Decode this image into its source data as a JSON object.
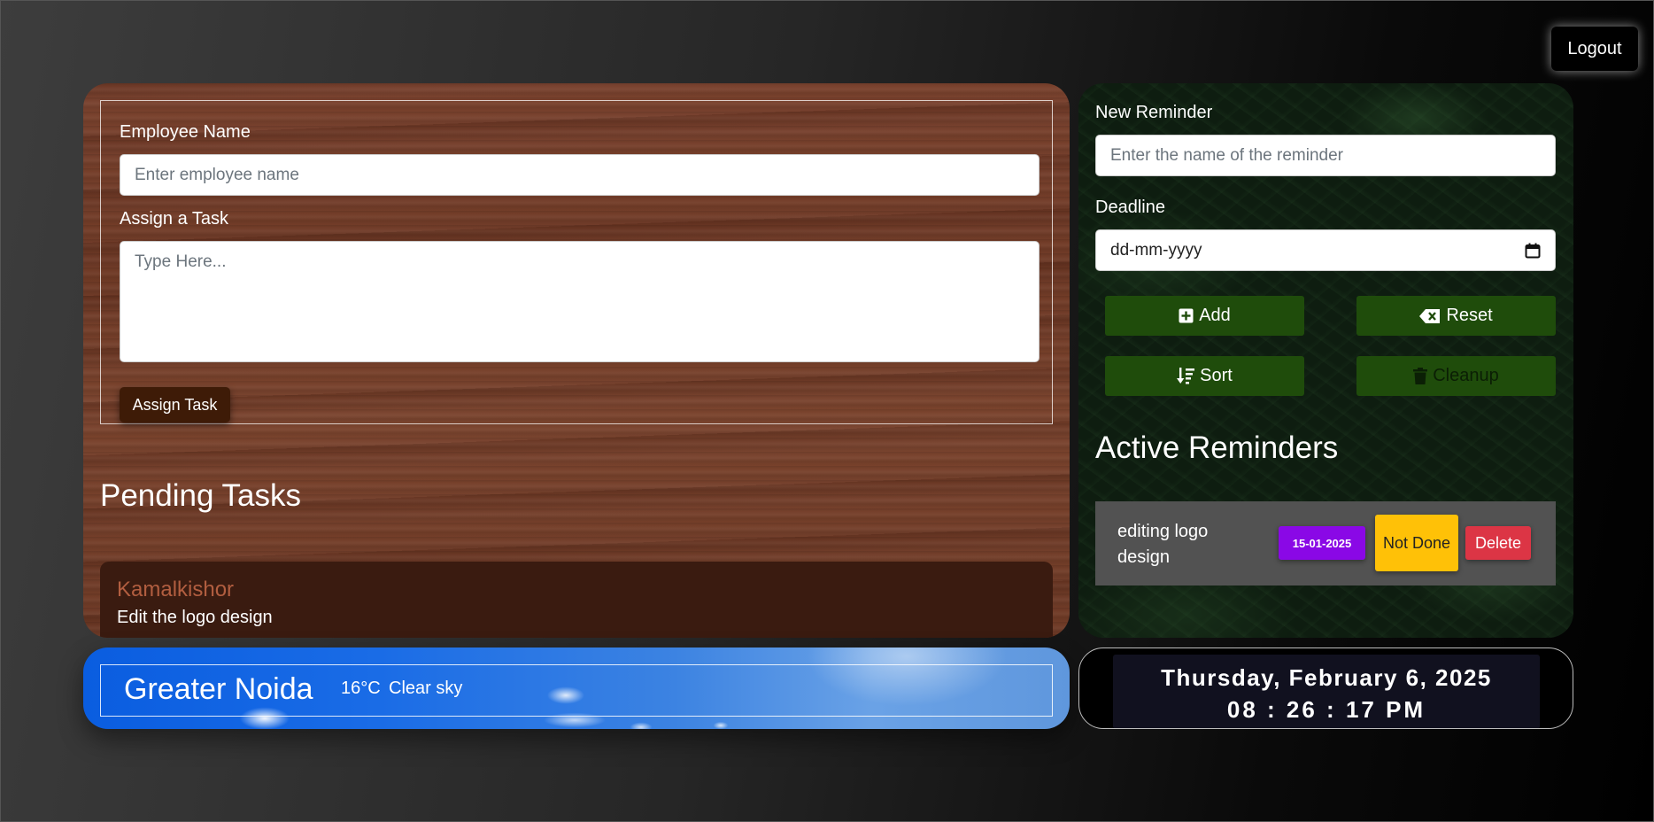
{
  "header": {
    "logout_label": "Logout"
  },
  "task_form": {
    "employee_label": "Employee Name",
    "employee_placeholder": "Enter employee name",
    "task_label": "Assign a Task",
    "task_placeholder": "Type Here...",
    "assign_button": "Assign Task"
  },
  "pending": {
    "title": "Pending Tasks",
    "tasks": [
      {
        "employee": "Kamalkishor",
        "task": "Edit the logo design"
      }
    ]
  },
  "reminder_form": {
    "name_label": "New Reminder",
    "name_placeholder": "Enter the name of the reminder",
    "deadline_label": "Deadline",
    "deadline_placeholder": "dd-mm-yyyy",
    "buttons": {
      "add": "Add",
      "reset": "Reset",
      "sort": "Sort",
      "cleanup": "Cleanup"
    }
  },
  "active_reminders": {
    "title": "Active Reminders",
    "items": [
      {
        "name": "editing logo design",
        "date": "15-01-2025",
        "status_button": "Not Done",
        "delete_button": "Delete"
      }
    ]
  },
  "weather": {
    "city": "Greater Noida",
    "temperature": "16°C",
    "condition": "Clear sky"
  },
  "clock": {
    "date": "Thursday, February 6, 2025",
    "time": "08 : 26 : 17 PM"
  },
  "icons": {
    "add": "plus-square-icon",
    "reset": "backspace-icon",
    "sort": "sort-amount-down-icon",
    "cleanup": "trash-icon",
    "calendar": "calendar-icon"
  },
  "colors": {
    "assign_button": "#3e1b07",
    "reminder_button": "#1f4c0b",
    "date_badge": "#8a08e6",
    "not_done": "#ffc107",
    "delete": "#dc3545",
    "employee_name": "#b25e40"
  }
}
